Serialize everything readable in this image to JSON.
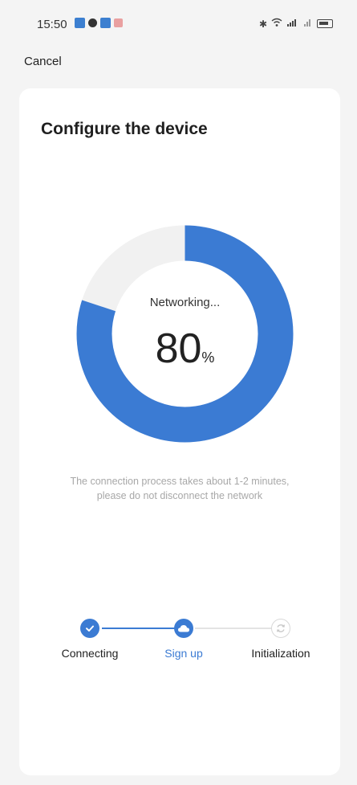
{
  "status_bar": {
    "time": "15:50"
  },
  "header": {
    "cancel_label": "Cancel"
  },
  "card": {
    "title": "Configure the device"
  },
  "progress": {
    "status_text": "Networking...",
    "value": "80",
    "unit": "%",
    "fraction": 0.8,
    "color": "#3b7bd3",
    "track_color": "#f1f1f1"
  },
  "hint": {
    "line1": "The connection process takes about 1-2 minutes,",
    "line2": "please do not disconnect the network"
  },
  "steps": [
    {
      "label": "Connecting",
      "state": "done",
      "icon": "check-icon"
    },
    {
      "label": "Sign up",
      "state": "active",
      "icon": "cloud-icon"
    },
    {
      "label": "Initialization",
      "state": "pending",
      "icon": "refresh-icon"
    }
  ]
}
